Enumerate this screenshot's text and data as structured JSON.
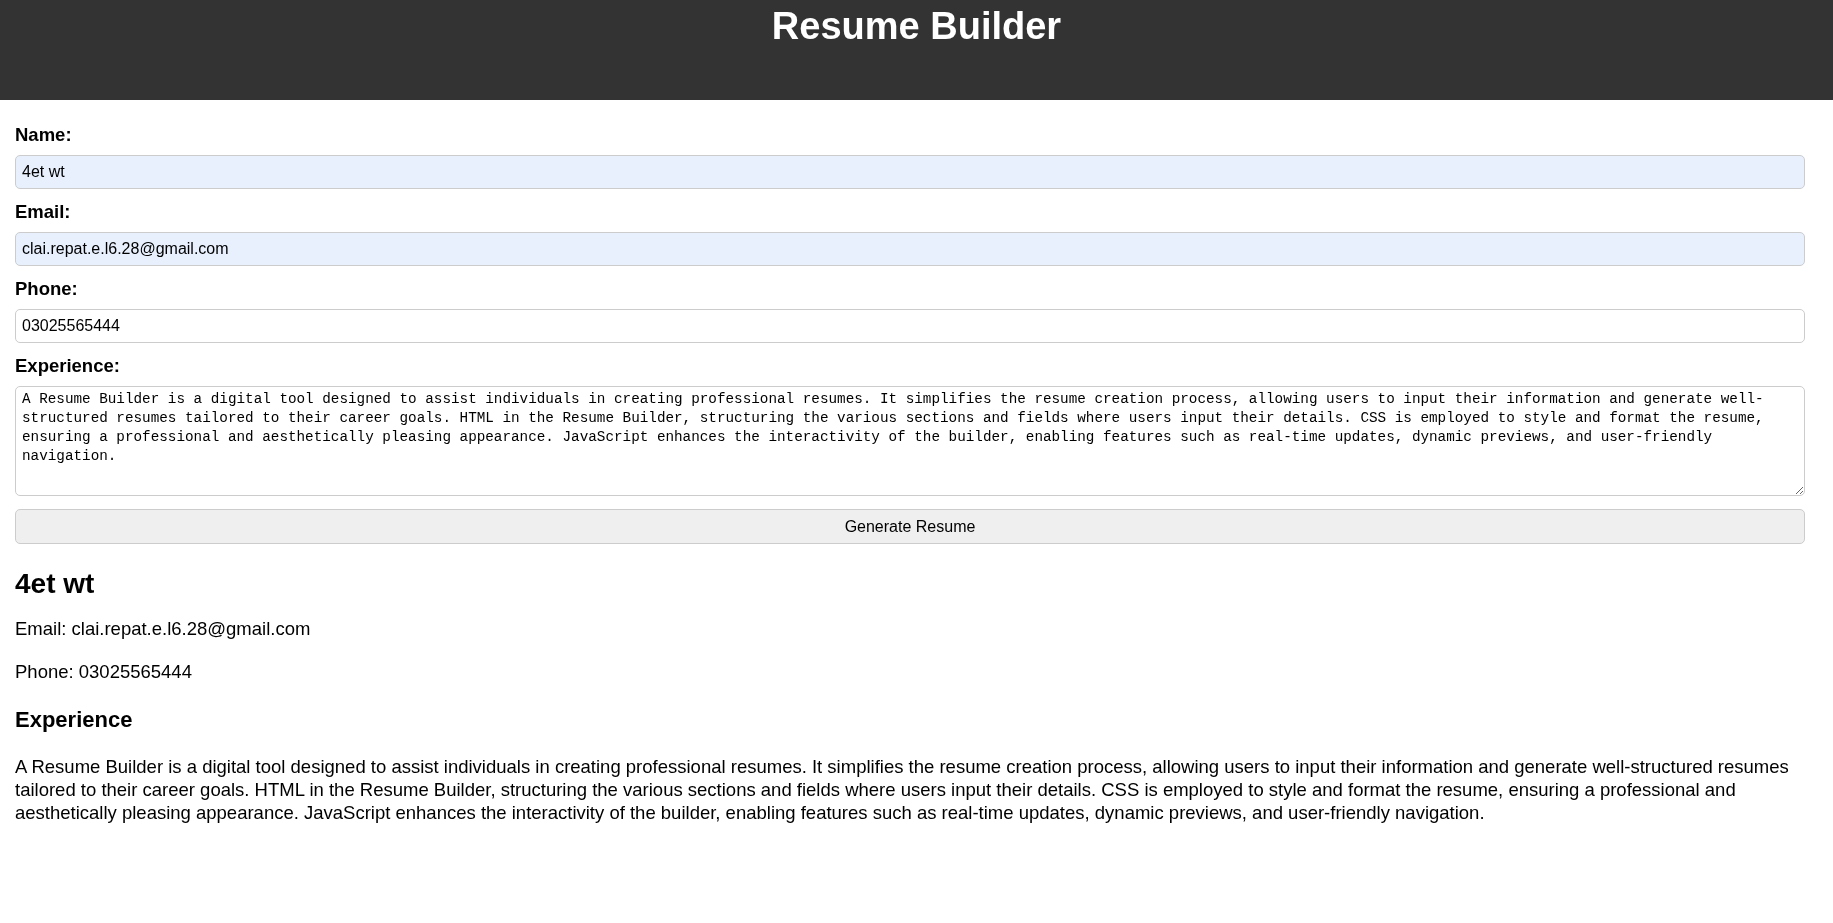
{
  "header": {
    "title": "Resume Builder"
  },
  "form": {
    "fields": [
      {
        "kind": "input",
        "label": "Name:",
        "value": "4et wt",
        "autofilled": true
      },
      {
        "kind": "input",
        "label": "Email:",
        "value": "clai.repat.e.l6.28@gmail.com",
        "autofilled": true
      },
      {
        "kind": "input",
        "label": "Phone:",
        "value": "03025565444",
        "autofilled": false
      },
      {
        "kind": "textarea",
        "label": "Experience:",
        "value": "A Resume Builder is a digital tool designed to assist individuals in creating professional resumes. It simplifies the resume creation process, allowing users to input their information and generate well-structured resumes tailored to their career goals. HTML in the Resume Builder, structuring the various sections and fields where users input their details. CSS is employed to style and format the resume, ensuring a professional and aesthetically pleasing appearance. JavaScript enhances the interactivity of the builder, enabling features such as real-time updates, dynamic previews, and user-friendly navigation.",
        "autofilled": false
      }
    ],
    "button": "Generate Resume"
  },
  "resume": {
    "name": "4et wt",
    "lines": [
      "Email: clai.repat.e.l6.28@gmail.com",
      "Phone: 03025565444"
    ],
    "section_title": "Experience",
    "section_text": "A Resume Builder is a digital tool designed to assist individuals in creating professional resumes. It simplifies the resume creation process, allowing users to input their information and generate well-structured resumes tailored to their career goals. HTML in the Resume Builder, structuring the various sections and fields where users input their details. CSS is employed to style and format the resume, ensuring a professional and aesthetically pleasing appearance. JavaScript enhances the interactivity of the builder, enabling features such as real-time updates, dynamic previews, and user-friendly navigation."
  }
}
